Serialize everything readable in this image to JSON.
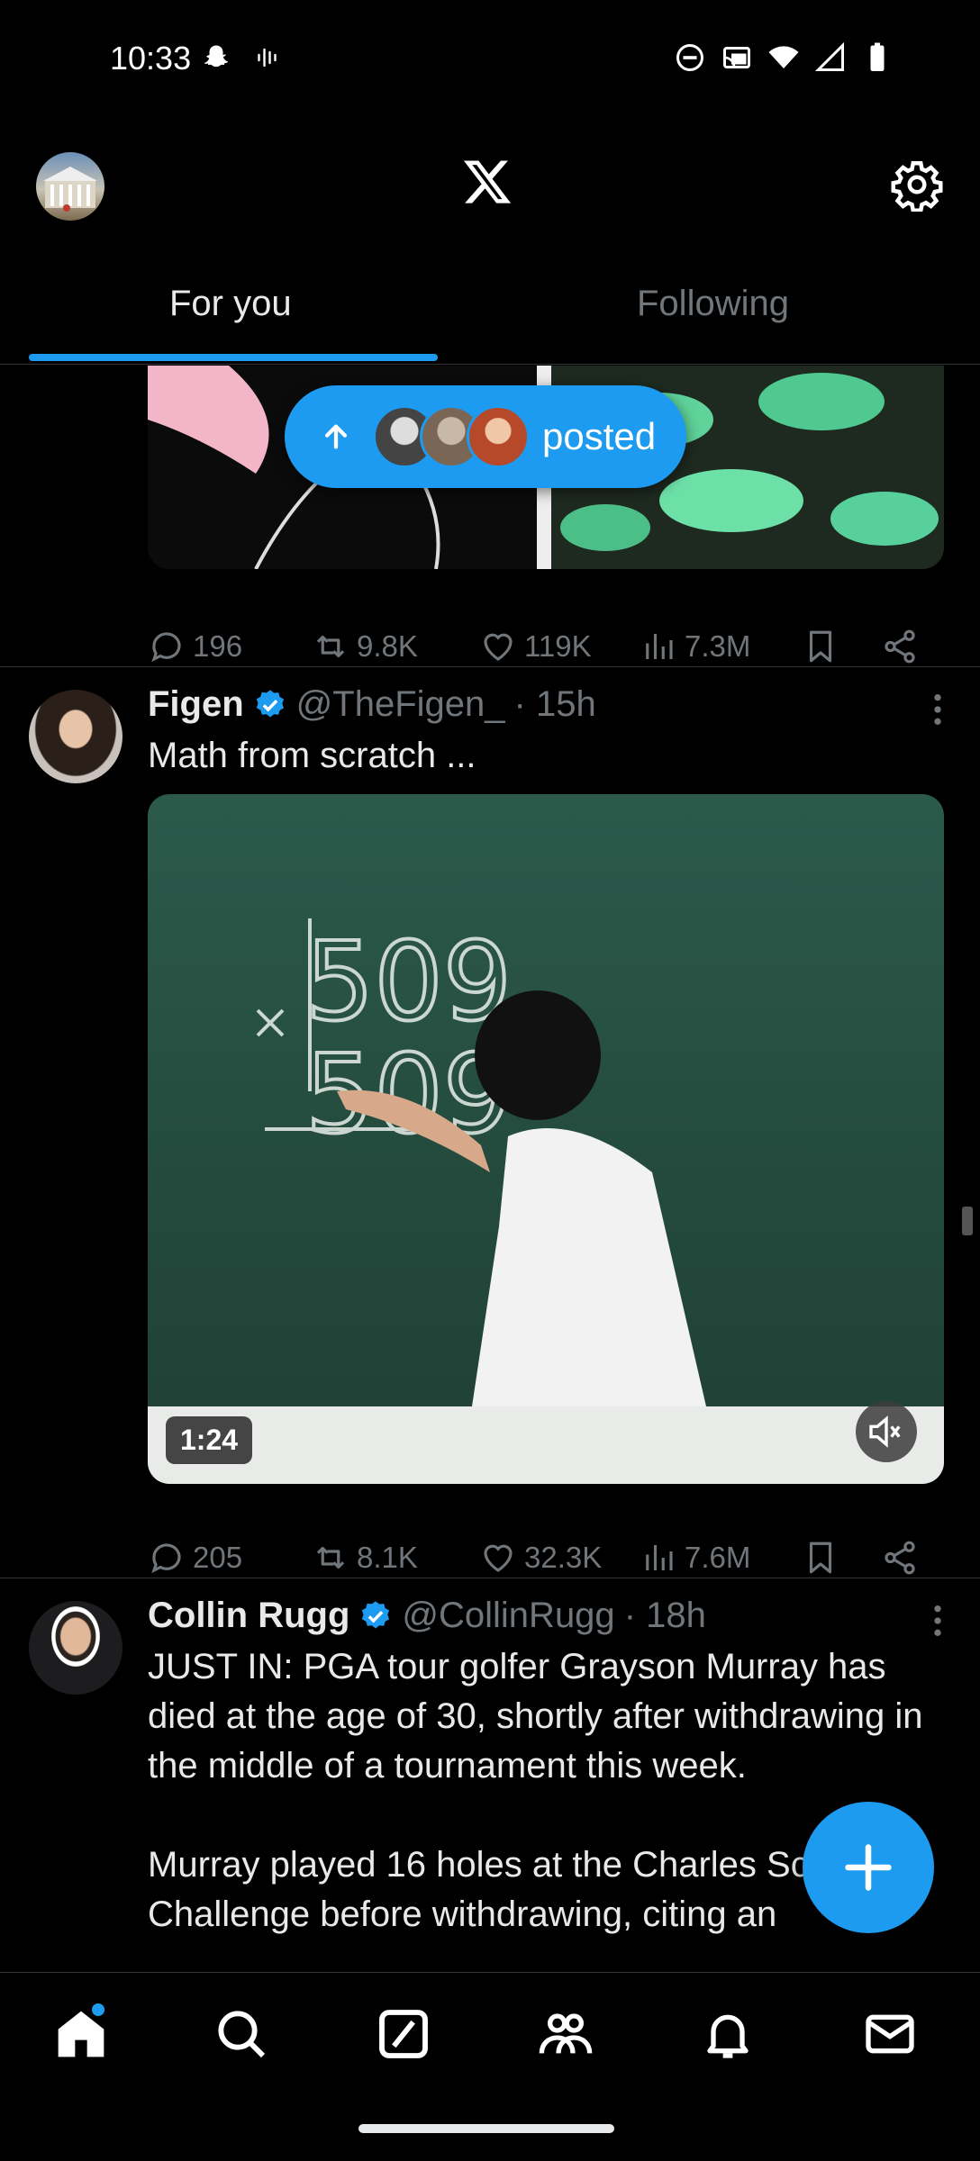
{
  "status_bar": {
    "time": "10:33"
  },
  "top_bar": {
    "logo": "X"
  },
  "tabs": [
    {
      "label": "For you",
      "selected": true
    },
    {
      "label": "Following",
      "selected": false
    }
  ],
  "new_posts_pill": {
    "label": "posted"
  },
  "posts": [
    {
      "stats": {
        "replies": "196",
        "reposts": "9.8K",
        "likes": "119K",
        "views": "7.3M"
      }
    },
    {
      "name": "Figen",
      "handle": "@TheFigen_",
      "time": "· 15h",
      "text": "Math from scratch ...",
      "video_duration": "1:24",
      "stats": {
        "replies": "205",
        "reposts": "8.1K",
        "likes": "32.3K",
        "views": "7.6M"
      }
    },
    {
      "name": "Collin Rugg",
      "handle": "@CollinRugg",
      "time": "· 18h",
      "text_p1": "JUST IN: PGA tour golfer Grayson Murray has died at the age of 30, shortly after withdrawing in the middle of a tournament this week.",
      "text_p2": "Murray played 16 holes at the Charles Schwab Challenge before withdrawing, citing an"
    }
  ],
  "colors": {
    "accent": "#1d9bf0",
    "background": "#000000",
    "muted": "#71767b",
    "text": "#e7e9ea"
  }
}
